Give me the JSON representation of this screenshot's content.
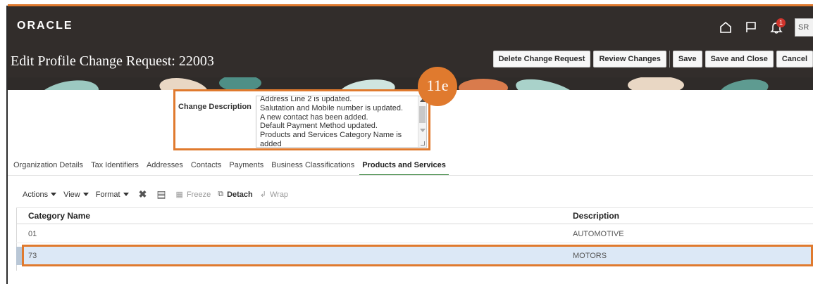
{
  "brand": {
    "logo": "ORACLE",
    "accent": "#e07a2e",
    "header_bg": "#322d2b"
  },
  "topbar": {
    "icons": [
      "home-icon",
      "flag-icon",
      "notifications-icon"
    ],
    "notification_count": "1",
    "user_initials": "SR"
  },
  "page": {
    "title": "Edit Profile Change Request: 22003"
  },
  "actions": {
    "delete_change_request": "Delete Change Request",
    "review_changes": "Review Changes",
    "save": "Save",
    "save_and_close": "Save and Close",
    "cancel": "Cancel"
  },
  "change_description": {
    "label": "Change Description",
    "lines": [
      "Address Line 2 is updated.",
      "Salutation and Mobile number is updated.",
      "A new contact has been added.",
      "Default Payment Method updated.",
      "Products and Services Category Name is",
      "added"
    ]
  },
  "step_badge": "11e",
  "tabs": [
    {
      "label": "Organization Details",
      "active": false
    },
    {
      "label": "Tax Identifiers",
      "active": false
    },
    {
      "label": "Addresses",
      "active": false
    },
    {
      "label": "Contacts",
      "active": false
    },
    {
      "label": "Payments",
      "active": false
    },
    {
      "label": "Business Classifications",
      "active": false
    },
    {
      "label": "Products and Services",
      "active": true
    }
  ],
  "toolbar": {
    "actions": "Actions",
    "view": "View",
    "format": "Format",
    "freeze": "Freeze",
    "detach": "Detach",
    "wrap": "Wrap"
  },
  "table": {
    "columns": [
      "Category Name",
      "Description"
    ],
    "rows": [
      {
        "category": "01",
        "description": "AUTOMOTIVE",
        "selected": false
      },
      {
        "category": "73",
        "description": "MOTORS",
        "selected": true
      }
    ]
  },
  "colors": {
    "selected_row": "#dce8f6",
    "active_tab_underline": "#2e7d32"
  }
}
